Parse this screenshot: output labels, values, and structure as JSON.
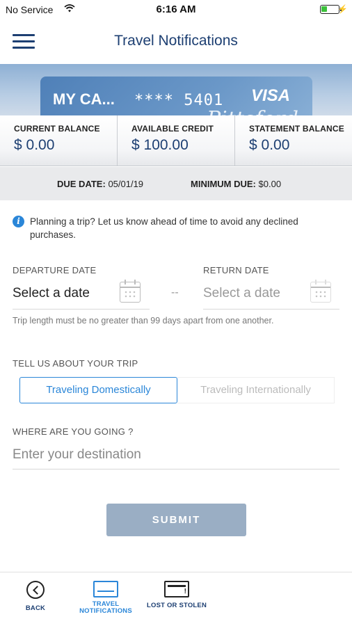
{
  "status_bar": {
    "carrier": "No Service",
    "time": "6:16 AM"
  },
  "header": {
    "title": "Travel Notifications"
  },
  "card": {
    "name": "MY CA...",
    "masked_number": "**** 5401",
    "brand": "VISA",
    "script_text": "Pittsford"
  },
  "balances": [
    {
      "label": "CURRENT BALANCE",
      "value": "$ 0.00"
    },
    {
      "label": "AVAILABLE CREDIT",
      "value": "$ 100.00"
    },
    {
      "label": "STATEMENT BALANCE",
      "value": "$ 0.00"
    }
  ],
  "due": {
    "date_label": "DUE DATE:",
    "date_value": "05/01/19",
    "min_label": "MINIMUM DUE:",
    "min_value": "$0.00"
  },
  "info_text": "Planning a trip? Let us know ahead of time to avoid any declined purchases.",
  "departure": {
    "label": "DEPARTURE DATE",
    "value": "Select a date"
  },
  "return": {
    "label": "RETURN DATE",
    "value": "Select a date"
  },
  "separator": "--",
  "hint": "Trip length must be no greater than 99 days apart from one another.",
  "trip": {
    "label": "TELL US ABOUT YOUR TRIP",
    "options": [
      "Traveling Domestically",
      "Traveling Internationally"
    ],
    "selected": "Traveling Domestically"
  },
  "destination": {
    "label": "WHERE ARE YOU GOING ?",
    "placeholder": "Enter your destination"
  },
  "submit_label": "SUBMIT",
  "tabs": [
    {
      "label": "BACK",
      "icon": "back-icon"
    },
    {
      "label_line1": "TRAVEL",
      "label_line2": "NOTIFICATIONS",
      "icon": "travel-card-icon"
    },
    {
      "label": "LOST OR STOLEN",
      "icon": "lost-card-icon"
    }
  ],
  "colors": {
    "brand_navy": "#1d3f72",
    "accent_blue": "#2a86d8",
    "submit_disabled": "#9aaec4"
  }
}
